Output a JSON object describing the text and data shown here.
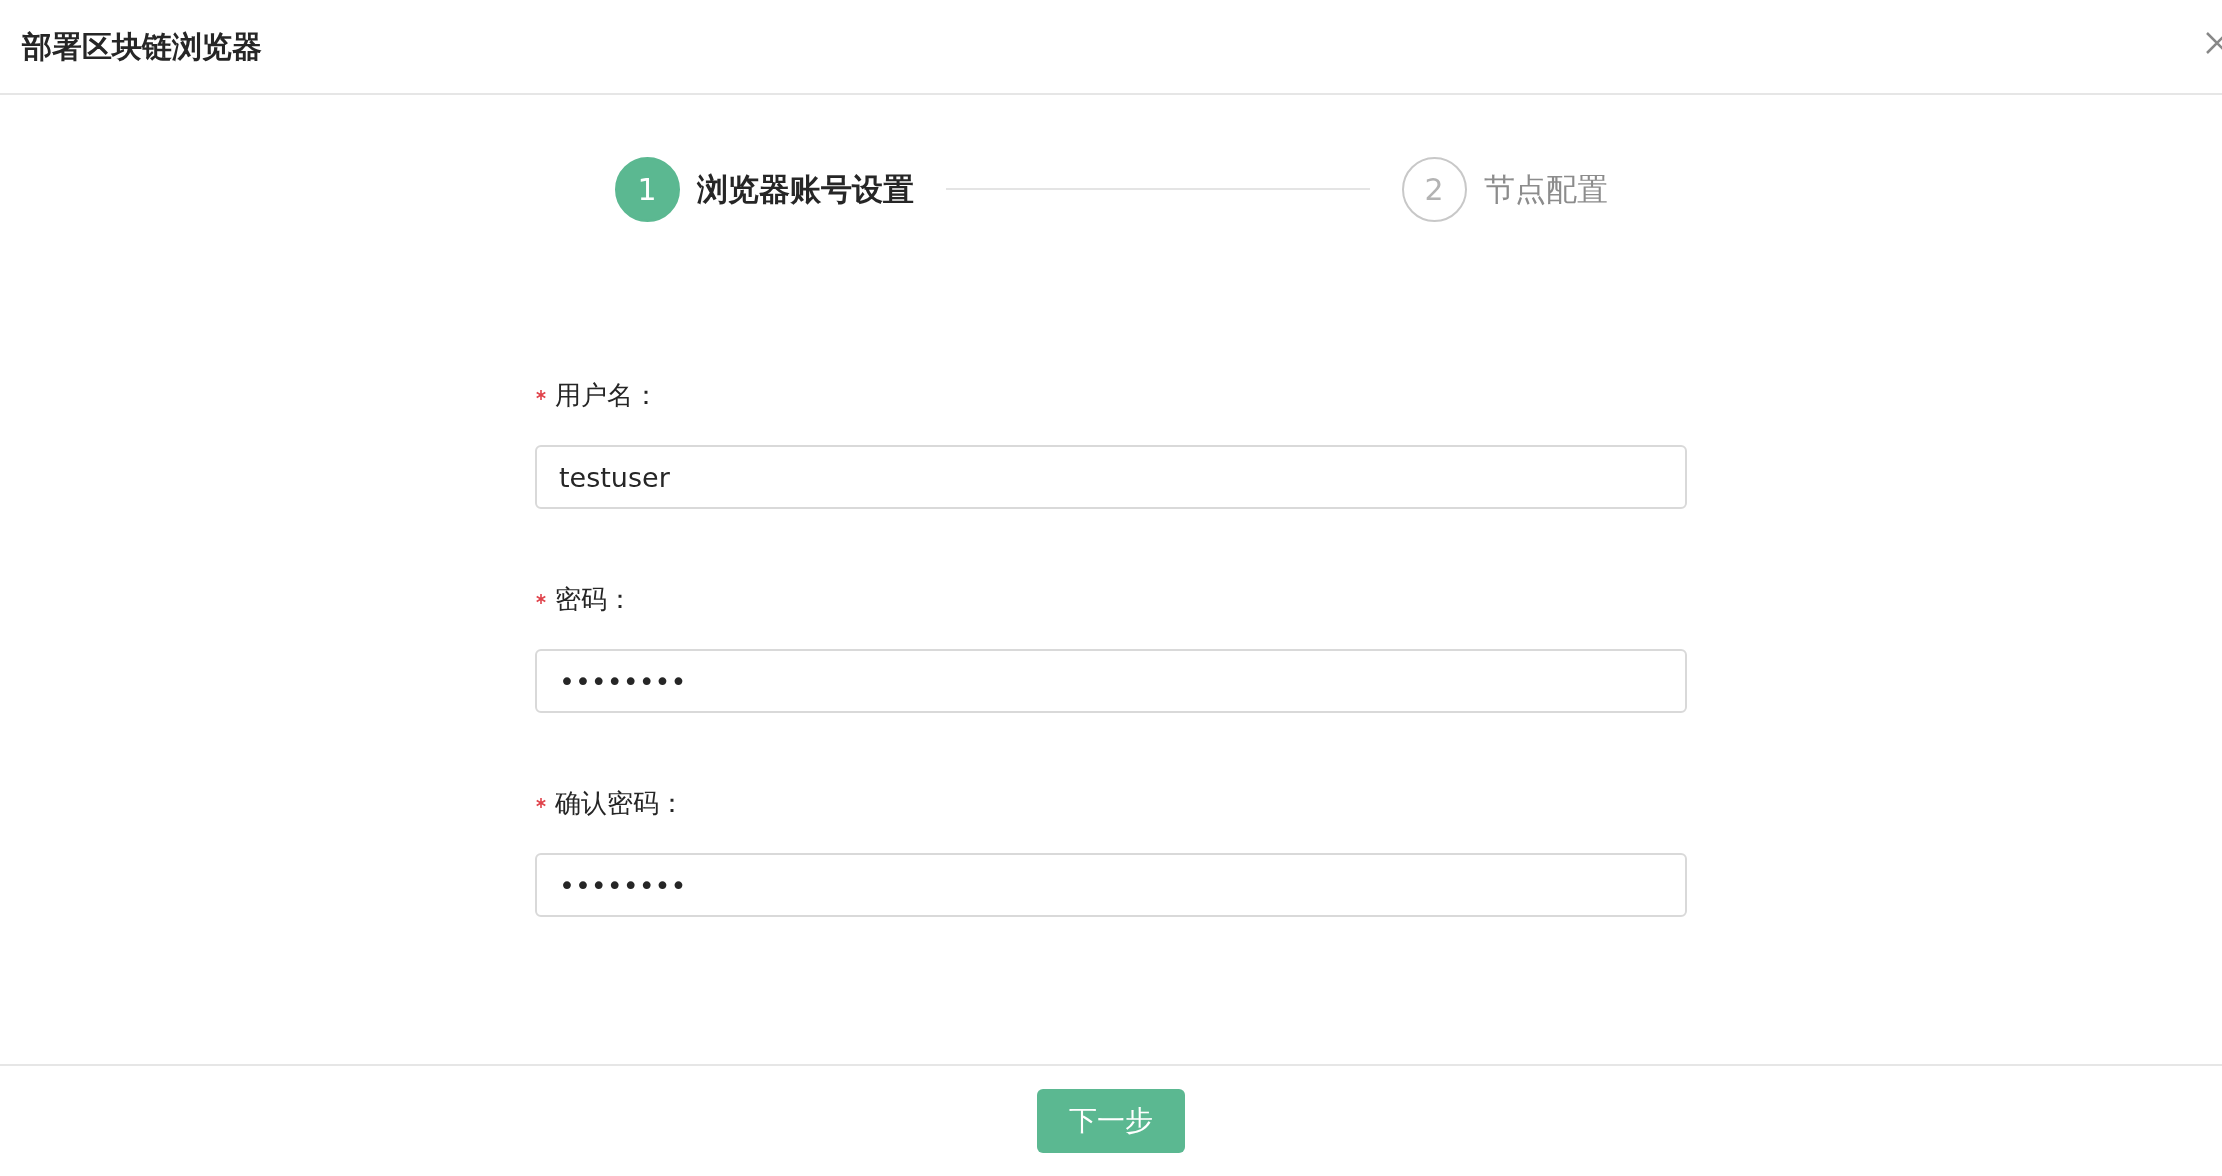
{
  "dialog": {
    "title": "部署区块链浏览器"
  },
  "steps": [
    {
      "number": "1",
      "label": "浏览器账号设置",
      "selected": true
    },
    {
      "number": "2",
      "label": "节点配置",
      "selected": false
    }
  ],
  "fields": [
    {
      "label": "用户名：",
      "required": true,
      "value": "testuser"
    },
    {
      "label": "密码：",
      "required": true,
      "value": "••••••••"
    },
    {
      "label": "确认密码：",
      "required": true,
      "value": "••••••••"
    }
  ],
  "footer": {
    "button": "下一步"
  }
}
